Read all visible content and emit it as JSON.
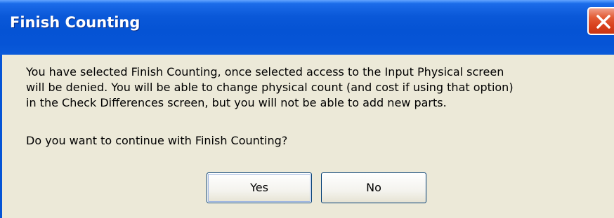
{
  "dialog": {
    "title": "Finish Counting",
    "message_lines": [
      "You have selected Finish Counting, once selected access to the Input Physical screen",
      "will be denied. You will be able to change physical count (and cost if using that option)",
      "in the Check Differences screen, but you will not be able to add new parts."
    ],
    "question": "Do you want to continue with Finish Counting?",
    "buttons": {
      "yes_label": "Yes",
      "no_label": "No"
    },
    "close_icon": "close-icon"
  },
  "colors": {
    "titlebar": "#0553d4",
    "close_button": "#d8401c",
    "dialog_background": "#ece9d8"
  }
}
